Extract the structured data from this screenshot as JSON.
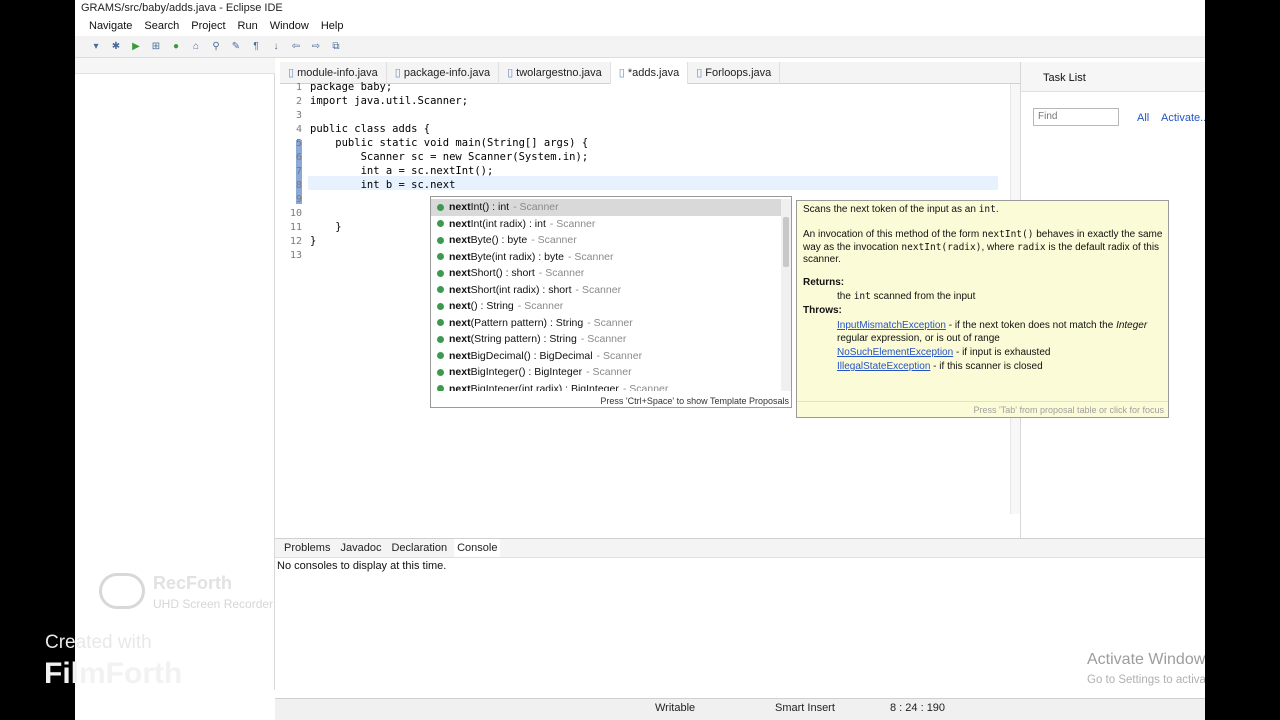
{
  "window": {
    "title": "GRAMS/src/baby/adds.java - Eclipse IDE"
  },
  "menu": [
    "Navigate",
    "Search",
    "Project",
    "Run",
    "Window",
    "Help"
  ],
  "editor_tabs": [
    "module-info.java",
    "package-info.java",
    "twolargestno.java",
    "*adds.java",
    "Forloops.java"
  ],
  "code_lines": [
    "package baby;",
    "import java.util.Scanner;",
    "",
    "public class adds {",
    "    public static void main(String[] args) {",
    "        Scanner sc = new Scanner(System.in);",
    "        int a = sc.nextInt();",
    "        int b = sc.next",
    "",
    "",
    "    }",
    "}",
    ""
  ],
  "line_numbers": [
    "1",
    "2",
    "3",
    "4",
    "5",
    "6",
    "7",
    "8",
    "9",
    "10",
    "11",
    "12",
    "13"
  ],
  "completion": {
    "items": [
      {
        "bold": "next",
        "rest": "Int() : int",
        "owner": "- Scanner"
      },
      {
        "bold": "next",
        "rest": "Int(int radix) : int",
        "owner": "- Scanner"
      },
      {
        "bold": "next",
        "rest": "Byte() : byte",
        "owner": "- Scanner"
      },
      {
        "bold": "next",
        "rest": "Byte(int radix) : byte",
        "owner": "- Scanner"
      },
      {
        "bold": "next",
        "rest": "Short() : short",
        "owner": "- Scanner"
      },
      {
        "bold": "next",
        "rest": "Short(int radix) : short",
        "owner": "- Scanner"
      },
      {
        "bold": "next",
        "rest": "() : String",
        "owner": "- Scanner"
      },
      {
        "bold": "next",
        "rest": "(Pattern pattern) : String",
        "owner": "- Scanner"
      },
      {
        "bold": "next",
        "rest": "(String pattern) : String",
        "owner": "- Scanner"
      },
      {
        "bold": "next",
        "rest": "BigDecimal() : BigDecimal",
        "owner": "- Scanner"
      },
      {
        "bold": "next",
        "rest": "BigInteger() : BigInteger",
        "owner": "- Scanner"
      },
      {
        "bold": "next",
        "rest": "BigInteger(int radix) : BigInteger",
        "owner": "- Scanner"
      }
    ],
    "hint": "Press 'Ctrl+Space' to show Template Proposals"
  },
  "javadoc": {
    "line1a": "Scans the next token of the input as an ",
    "line1b": "int",
    "line1c": ".",
    "p2a": "An invocation of this method of the form ",
    "p2b": "nextInt()",
    "p2c": " behaves in exactly the same way as the invocation ",
    "p2d": "nextInt(radix)",
    "p2e": ", where ",
    "p2f": "radix",
    "p2g": " is the default radix of this scanner.",
    "returns_label": "Returns:",
    "returns_a": "the ",
    "returns_b": "int",
    "returns_c": " scanned from the input",
    "throws_label": "Throws:",
    "ex1": "InputMismatchException",
    "ex1_text": " - if the next token does not match the ",
    "ex1_italic": "Integer",
    "ex1_text2": " regular expression, or is out of range",
    "ex2": "NoSuchElementException",
    "ex2_text": " - if input is exhausted",
    "ex3": "IllegalStateException",
    "ex3_text": " - if this scanner is closed",
    "footer": "Press 'Tab' from proposal table or click for focus"
  },
  "task_list": {
    "title": "Task List",
    "find_placeholder": "Find",
    "all": "All",
    "activate": "Activate..."
  },
  "console_tabs": [
    "Problems",
    "Javadoc",
    "Declaration",
    "Console"
  ],
  "console_msg": "No consoles to display at this time.",
  "status": {
    "writable": "Writable",
    "insert": "Smart Insert",
    "position": "8 : 24 : 190"
  },
  "windows_watermark": {
    "line1": "Activate Windows",
    "line2": "Go to Settings to activate Windows."
  },
  "overlay": {
    "recforth": "RecForth",
    "recforth_sub": "UHD Screen Recorder",
    "created_with": "Created with",
    "filmforth": "FilmForth"
  }
}
